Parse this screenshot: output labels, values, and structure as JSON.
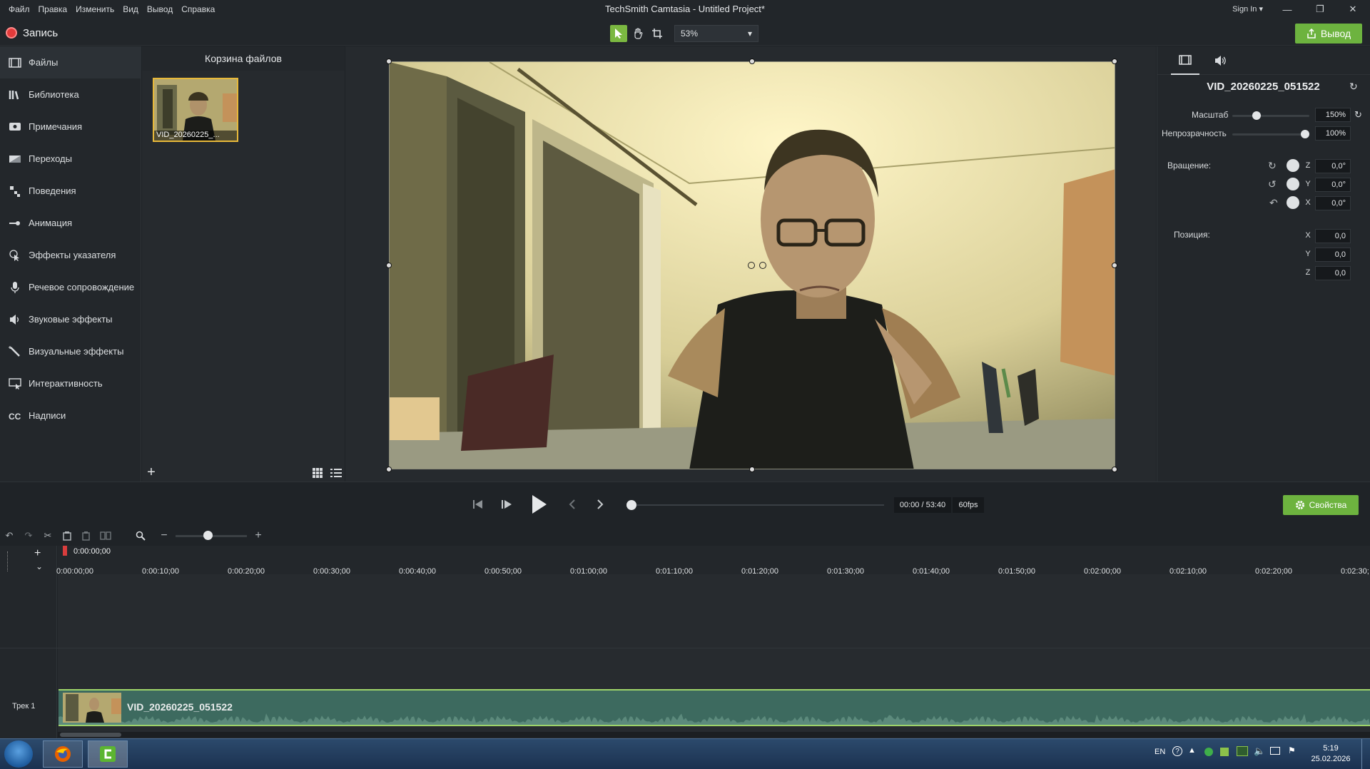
{
  "window": {
    "title": "TechSmith Camtasia - Untitled Project*",
    "menu": [
      "Файл",
      "Правка",
      "Изменить",
      "Вид",
      "Вывод",
      "Справка"
    ],
    "sign_in": "Sign In ▾"
  },
  "toolbar": {
    "record_label": "Запись",
    "zoom_value": "53%",
    "export_label": "Вывод",
    "accent_color": "#6db33f"
  },
  "sidebar": {
    "items": [
      {
        "label": "Файлы",
        "icon": "film-icon"
      },
      {
        "label": "Библиотека",
        "icon": "library-icon"
      },
      {
        "label": "Примечания",
        "icon": "annotation-icon"
      },
      {
        "label": "Переходы",
        "icon": "transition-icon"
      },
      {
        "label": "Поведения",
        "icon": "behavior-icon"
      },
      {
        "label": "Анимация",
        "icon": "animation-icon"
      },
      {
        "label": "Эффекты указателя",
        "icon": "cursor-effect-icon"
      },
      {
        "label": "Речевое сопровождение",
        "icon": "microphone-icon"
      },
      {
        "label": "Звуковые эффекты",
        "icon": "speaker-icon"
      },
      {
        "label": "Визуальные эффекты",
        "icon": "wand-icon"
      },
      {
        "label": "Интерактивность",
        "icon": "interactive-icon"
      },
      {
        "label": "Надписи",
        "icon": "cc-icon"
      }
    ]
  },
  "media_bin": {
    "title": "Корзина файлов",
    "clip_label": "VID_20260225_..."
  },
  "properties": {
    "clip_name": "VID_20260225_051522",
    "scale_label": "Масштаб",
    "scale_value": "150%",
    "opacity_label": "Непрозрачность",
    "opacity_value": "100%",
    "rotation_label": "Вращение:",
    "rotation": [
      {
        "axis": "Z",
        "value": "0,0°"
      },
      {
        "axis": "Y",
        "value": "0,0°"
      },
      {
        "axis": "X",
        "value": "0,0°"
      }
    ],
    "position_label": "Позиция:",
    "position": [
      {
        "axis": "X",
        "value": "0,0"
      },
      {
        "axis": "Y",
        "value": "0,0"
      },
      {
        "axis": "Z",
        "value": "0,0"
      }
    ]
  },
  "playback": {
    "time": "00:00 / 53:40",
    "fps": "60fps",
    "properties_label": "Свойства"
  },
  "timeline": {
    "playhead_time": "0:00:00;00",
    "ticks": [
      "0:00:00;00",
      "0:00:10;00",
      "0:00:20;00",
      "0:00:30;00",
      "0:00:40;00",
      "0:00:50;00",
      "0:01:00;00",
      "0:01:10;00",
      "0:01:20;00",
      "0:01:30;00",
      "0:01:40;00",
      "0:01:50;00",
      "0:02:00;00",
      "0:02:10;00",
      "0:02:20;00",
      "0:02:30;"
    ],
    "track_label": "Трек 1",
    "clip_label": "VID_20260225_051522"
  },
  "taskbar": {
    "lang": "EN",
    "time": "5:19",
    "date": "25.02.2026"
  }
}
